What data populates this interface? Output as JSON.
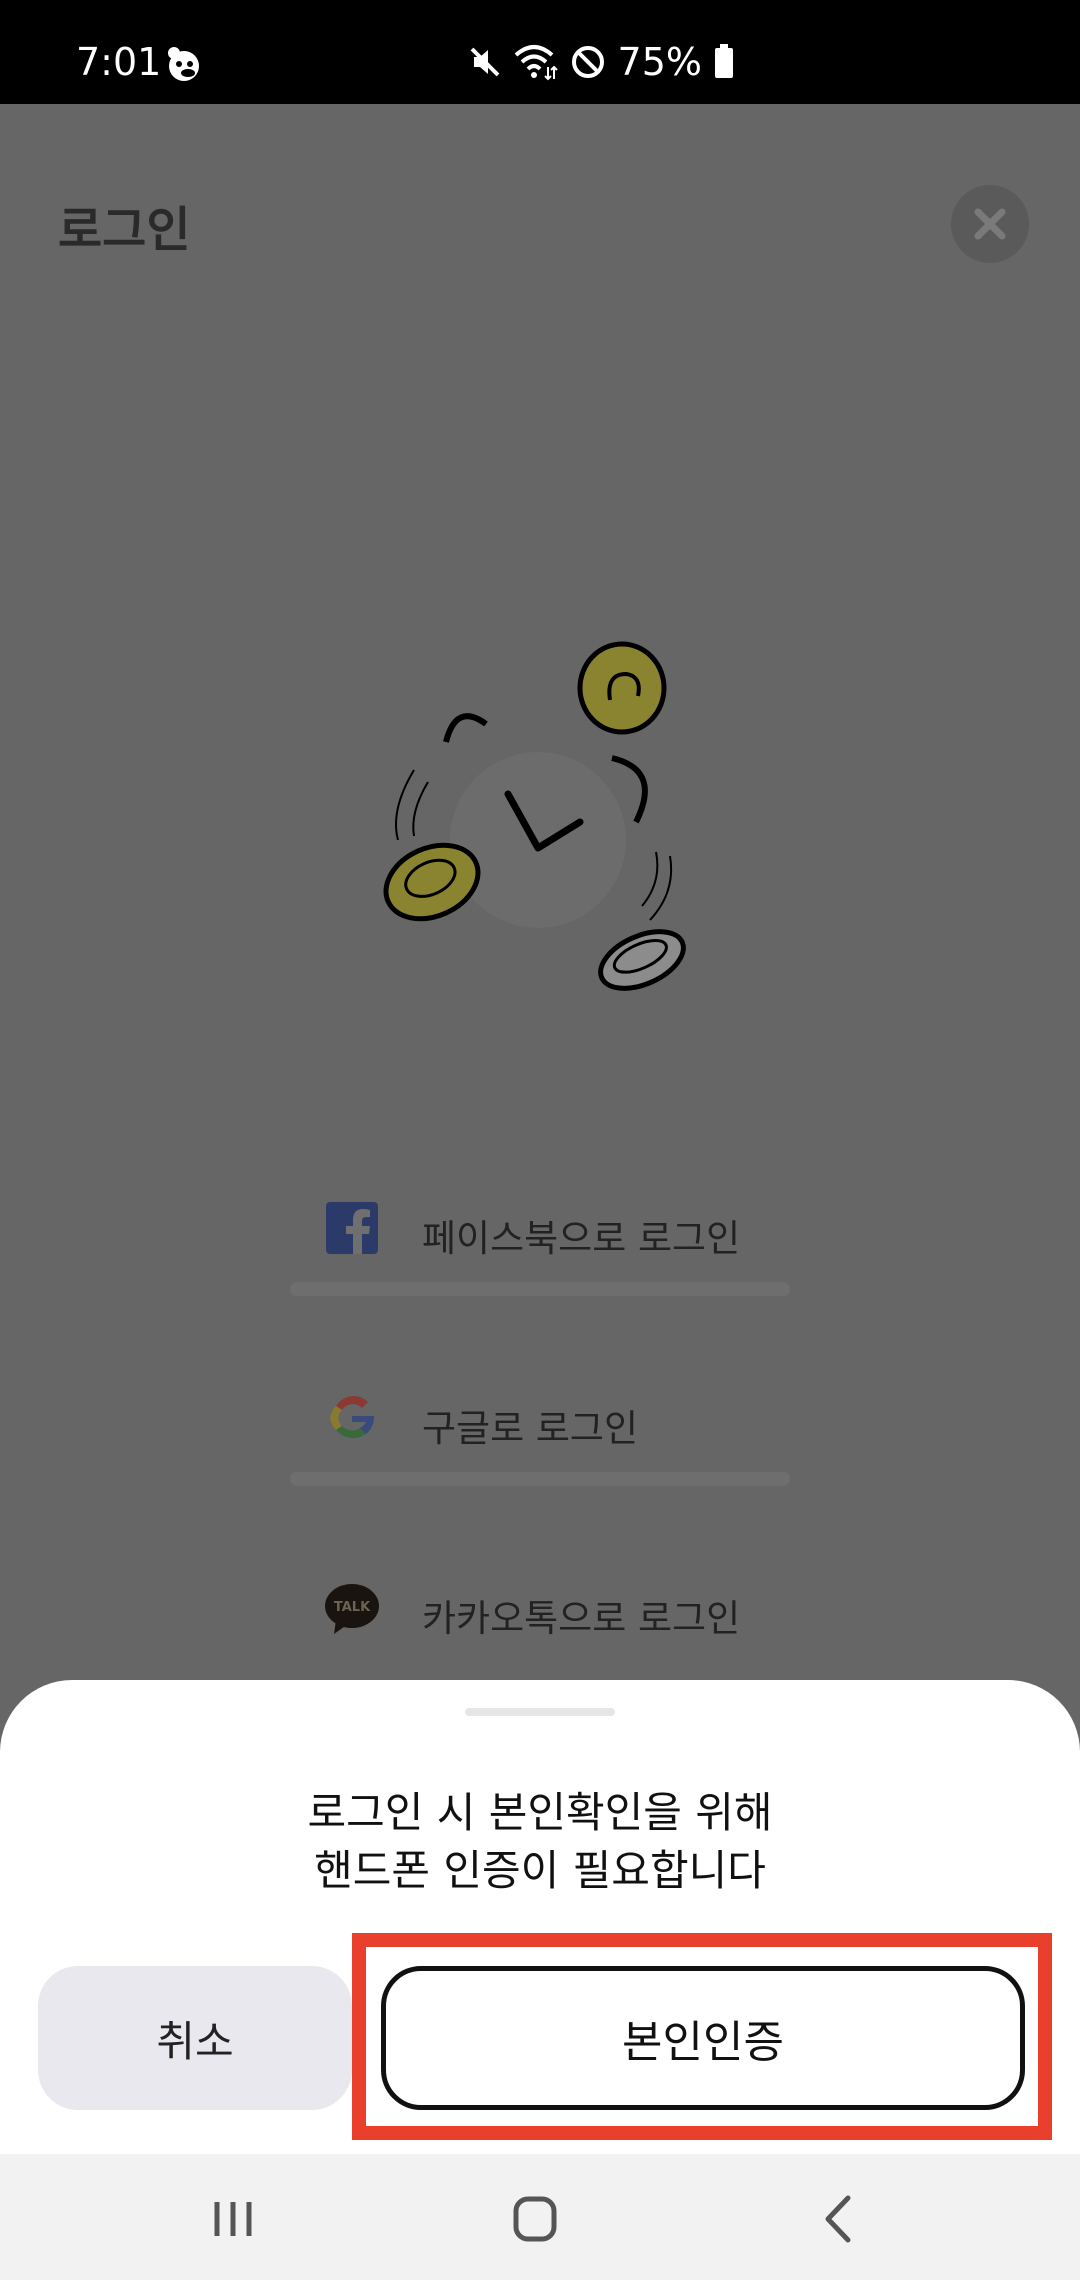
{
  "status_bar": {
    "time": "7:01",
    "battery": "75%",
    "icons": [
      "app-notification-icon",
      "mute-icon",
      "wifi-icon",
      "do-not-disturb-icon",
      "battery-icon"
    ]
  },
  "page": {
    "title": "로그인",
    "close_icon": "close-icon",
    "login_options": [
      {
        "label": "페이스북으로 로그인",
        "icon": "facebook-icon"
      },
      {
        "label": "구글로 로그인",
        "icon": "google-icon"
      },
      {
        "label": "카카오톡으로 로그인",
        "icon": "kakaotalk-icon",
        "icon_text": "TALK"
      }
    ]
  },
  "sheet": {
    "message_line1": "로그인 시 본인확인을 위해",
    "message_line2": "핸드폰 인증이 필요합니다",
    "cancel_label": "취소",
    "confirm_label": "본인인증"
  },
  "colors": {
    "overlay": "#666666",
    "highlight": "#e8402c",
    "coin": "#8a8430"
  },
  "navbar": {
    "icons": [
      "recent-apps-icon",
      "home-icon",
      "back-icon"
    ]
  }
}
